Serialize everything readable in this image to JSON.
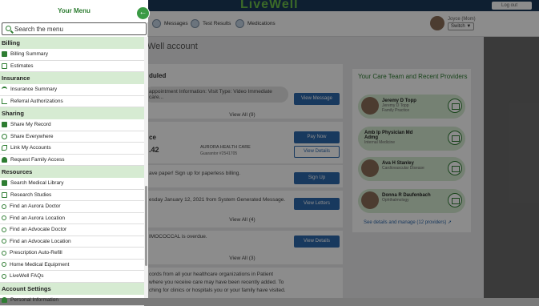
{
  "menu": {
    "title": "Your Menu",
    "search_placeholder": "Search the menu",
    "sections": [
      {
        "title": "Billing",
        "items": [
          {
            "label": "Billing Summary",
            "icon": "card-icon"
          },
          {
            "label": "Estimates",
            "icon": "document-icon"
          }
        ]
      },
      {
        "title": "Insurance",
        "items": [
          {
            "label": "Insurance Summary",
            "icon": "umbrella-icon"
          },
          {
            "label": "Referral Authorizations",
            "icon": "referral-icon"
          }
        ]
      },
      {
        "title": "Sharing",
        "items": [
          {
            "label": "Share My Record",
            "icon": "share-icon"
          },
          {
            "label": "Share Everywhere",
            "icon": "globe-icon"
          },
          {
            "label": "Link My Accounts",
            "icon": "link-icon"
          },
          {
            "label": "Request Family Access",
            "icon": "person-icon"
          }
        ]
      },
      {
        "title": "Resources",
        "items": [
          {
            "label": "Search Medical Library",
            "icon": "book-icon"
          },
          {
            "label": "Research Studies",
            "icon": "document-icon"
          },
          {
            "label": "Find an Aurora Doctor",
            "icon": "search-icon"
          },
          {
            "label": "Find an Aurora Location",
            "icon": "search-icon"
          },
          {
            "label": "Find an Advocate Doctor",
            "icon": "search-icon"
          },
          {
            "label": "Find an Advocate Location",
            "icon": "search-icon"
          },
          {
            "label": "Prescription Auto-Refill",
            "icon": "search-icon"
          },
          {
            "label": "Home Medical Equipment",
            "icon": "search-icon"
          },
          {
            "label": "LiveWell FAQs",
            "icon": "search-icon"
          }
        ]
      },
      {
        "title": "Account Settings",
        "items": [
          {
            "label": "Personal Information",
            "icon": "person-icon"
          }
        ]
      }
    ]
  },
  "header": {
    "brand": "LiveWell",
    "logout": "Log out",
    "nav": [
      {
        "label": "Messages",
        "icon": "messages-icon"
      },
      {
        "label": "Test Results",
        "icon": "test-results-icon"
      },
      {
        "label": "Medications",
        "icon": "medications-icon"
      }
    ],
    "user_name": "Joyce (Mom)",
    "switch_label": "Switch ▼"
  },
  "main": {
    "title": "Well account",
    "scheduled_heading": "duled",
    "appt_text": "appointment Information: Visit Type: Video Immediate care...",
    "view_message": "View Message",
    "view_all_9": "View All (9)",
    "billing_heading": "ce",
    "amount": ".42",
    "provider_org": "AURORA HEALTH CARE",
    "guarantor": "Guarantor #2541705",
    "pay_now": "Pay Now",
    "view_details": "View Details",
    "paperless": "ave paper! Sign up for paperless billing.",
    "sign_up": "Sign Up",
    "letter_text": "esday January 12, 2021 from System Generated Message.",
    "view_letters": "View Letters",
    "view_all_4": "View All (4)",
    "overdue": "IMOCOCCAL is overdue.",
    "view_details_2": "View Details",
    "view_all_3": "View All (3)",
    "records_line1": "cords from all your healthcare organizations in Patient",
    "records_line2": "where you receive care may have been recently added. To",
    "records_line3": "ching for clinics or hospitals you or your family have visited."
  },
  "care_team": {
    "heading": "Your Care Team and Recent Providers",
    "providers": [
      {
        "name": "Jeremy D Topp",
        "sub1": "Jeremy D Topp",
        "sub2": "Family Practice"
      },
      {
        "name": "Amb Ip Physician Md Admg",
        "sub1": "Internal Medicine",
        "sub2": ""
      },
      {
        "name": "Ava H Stanley",
        "sub1": "Cardiovascular Disease",
        "sub2": ""
      },
      {
        "name": "Donna R Daufenbach",
        "sub1": "Ophthalmology",
        "sub2": ""
      }
    ],
    "see_all": "See details and manage (12 providers) ➚"
  }
}
